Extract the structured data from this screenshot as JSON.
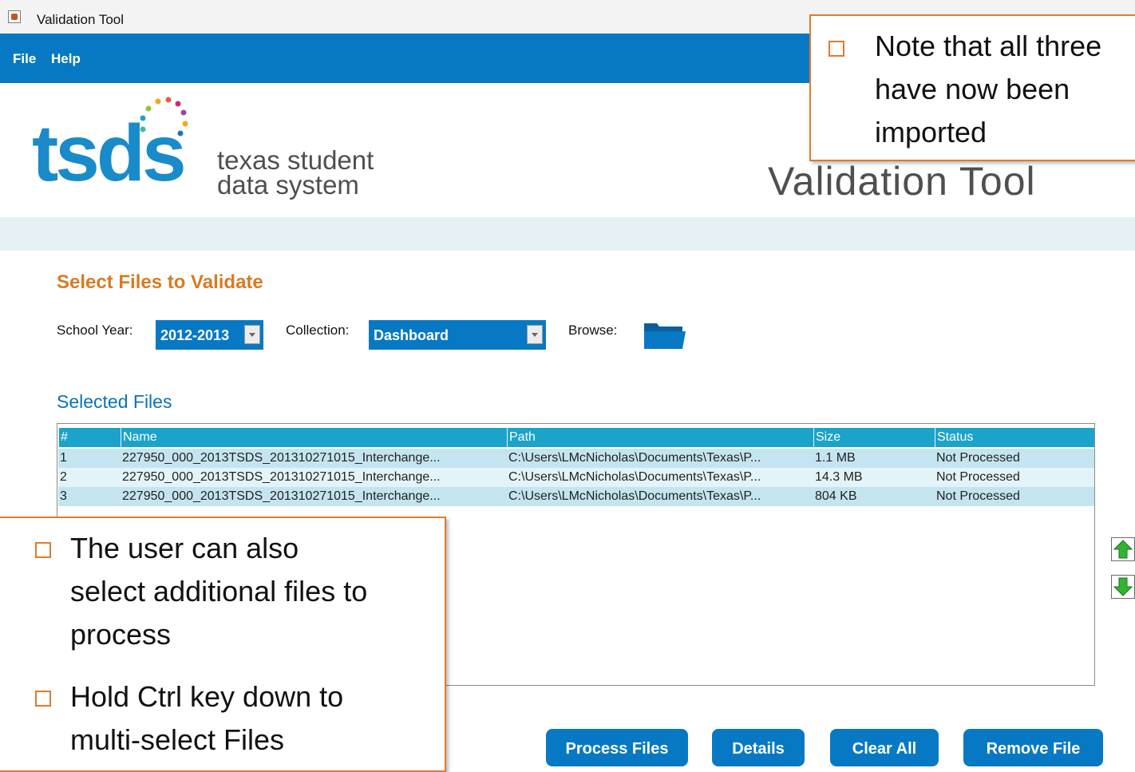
{
  "window": {
    "title": "Validation Tool"
  },
  "menu": {
    "file_label": "File",
    "help_label": "Help"
  },
  "logo": {
    "brand": "tsds",
    "tagline_line1": "texas student",
    "tagline_line2": "data system"
  },
  "header": {
    "app_title": "Validation Tool"
  },
  "select_section": {
    "title": "Select Files to Validate",
    "school_year_label": "School Year:",
    "school_year_value": "2012-2013",
    "collection_label": "Collection:",
    "collection_value": "Dashboard",
    "browse_label": "Browse:"
  },
  "selected_files": {
    "title": "Selected Files",
    "columns": [
      "#",
      "Name",
      "Path",
      "Size",
      "Status"
    ],
    "rows": [
      [
        "1",
        "227950_000_2013TSDS_201310271015_Interchange...",
        "C:\\Users\\LMcNicholas\\Documents\\Texas\\P...",
        "1.1 MB",
        "Not Processed"
      ],
      [
        "2",
        "227950_000_2013TSDS_201310271015_Interchange...",
        "C:\\Users\\LMcNicholas\\Documents\\Texas\\P...",
        "14.3 MB",
        "Not Processed"
      ],
      [
        "3",
        "227950_000_2013TSDS_201310271015_Interchange...",
        "C:\\Users\\LMcNicholas\\Documents\\Texas\\P...",
        "804 KB",
        "Not Processed"
      ]
    ]
  },
  "buttons": {
    "process_files": "Process Files",
    "details": "Details",
    "clear_all": "Clear All",
    "remove_file": "Remove File"
  },
  "callouts": {
    "top_right": [
      "Note that all three",
      "have now been",
      "imported"
    ],
    "bottom_left": {
      "bullet1": [
        "The user can also",
        "select additional files to",
        "process"
      ],
      "bullet2": [
        "Hold Ctrl key down  to",
        "multi-select Files"
      ]
    }
  },
  "colors": {
    "accent_blue": "#0779c4",
    "table_header": "#1ba3c9",
    "row_highlight": "#c4e5f0",
    "row_alt": "#e3f4f9",
    "section_orange": "#d97a23",
    "callout_border": "#e07b2b"
  }
}
